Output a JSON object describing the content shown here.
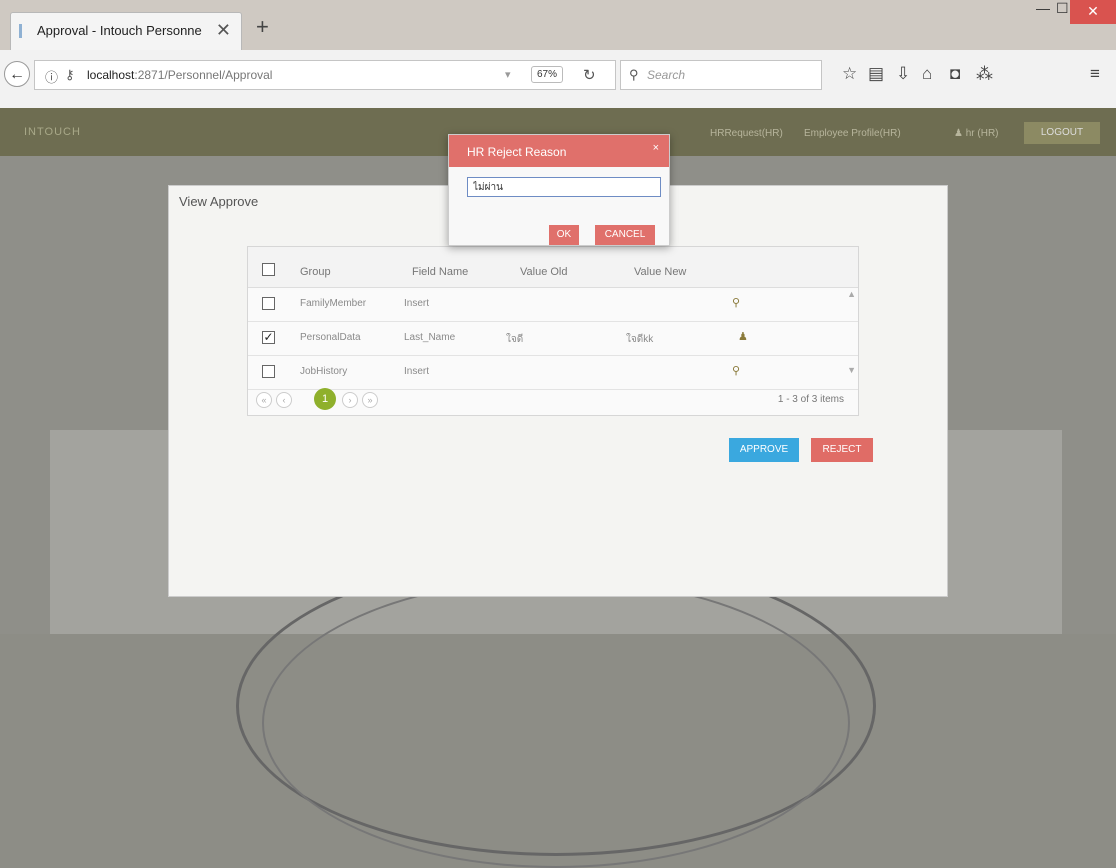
{
  "browser": {
    "tab_title": "Approval - Intouch Personne",
    "new_tab": "+",
    "tab_close": "✕",
    "url_host": "localhost",
    "url_path": ":2871/Personnel/Approval",
    "zoom": "67%",
    "search_placeholder": "Search"
  },
  "app": {
    "logo": "INTOUCH",
    "nav": [
      "HRRequest(HR)",
      "Employee Profile(HR)",
      "♟ hr (HR)"
    ],
    "logout": "LOGOUT"
  },
  "modal": {
    "title": "View Approve",
    "columns": [
      "Group",
      "Field Name",
      "Value Old",
      "Value New"
    ],
    "rows": [
      {
        "group": "FamilyMember",
        "field": "Insert",
        "old": "",
        "new": "",
        "checked": false,
        "action_icon": "search-icon"
      },
      {
        "group": "PersonalData",
        "field": "Last_Name",
        "old": "ใจดี",
        "new": "ใจดีkk",
        "checked": true,
        "action_icon": "user-icon"
      },
      {
        "group": "JobHistory",
        "field": "Insert",
        "old": "",
        "new": "",
        "checked": false,
        "action_icon": "search-icon"
      }
    ],
    "pager": {
      "first": "«",
      "prev": "‹",
      "current": "1",
      "next": "›",
      "last": "»",
      "info": "1 - 3 of 3 items"
    },
    "approve": "APPROVE",
    "reject": "REJECT"
  },
  "dialog": {
    "title": "HR Reject Reason",
    "close": "×",
    "input_value": "ไม่ผ่าน",
    "ok": "OK",
    "cancel": "CANCEL"
  },
  "colors": {
    "accent_green": "#8fb02c",
    "approve_blue": "#3aa8df",
    "reject_red": "#e06c66",
    "appbar": "#6e6d51"
  }
}
